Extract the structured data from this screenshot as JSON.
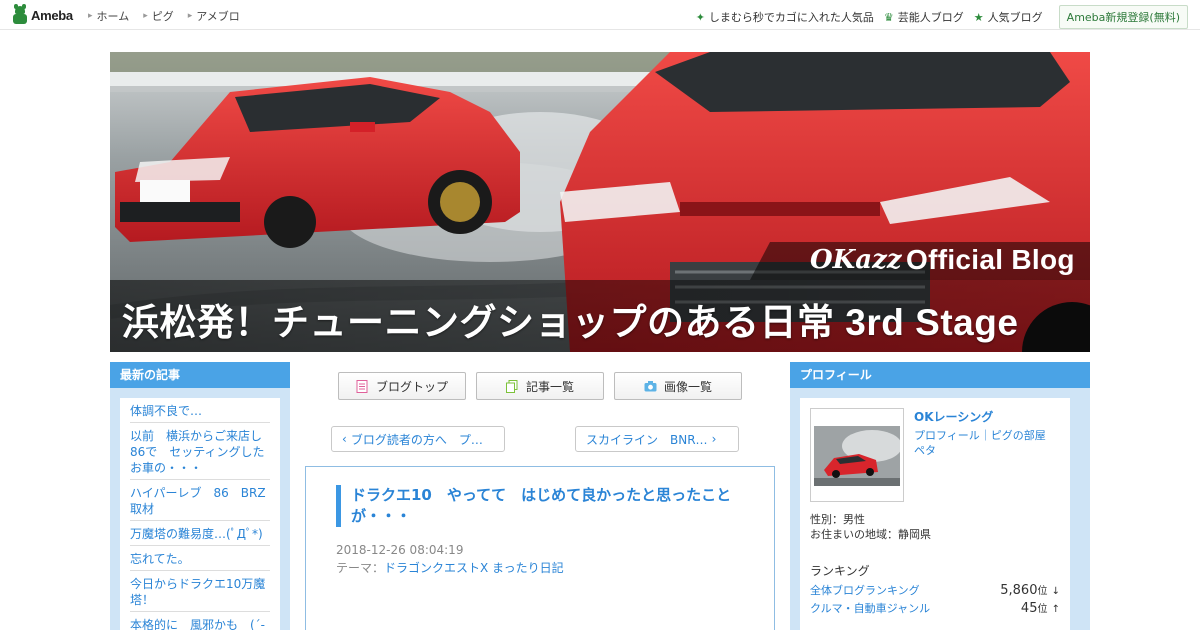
{
  "topbar": {
    "logo_text": "Ameba",
    "nav": [
      "ホーム",
      "ピグ",
      "アメブロ"
    ],
    "links": [
      {
        "label": "しまむら秒でカゴに入れた人気品",
        "icon": "sparkle-icon"
      },
      {
        "label": "芸能人ブログ",
        "icon": "crown-icon"
      },
      {
        "label": "人気ブログ",
        "icon": "star-icon"
      }
    ],
    "register_label": "Ameba新規登録(無料)"
  },
  "banner": {
    "signature": "OKazz",
    "official": "Official Blog",
    "title": "浜松発！チューニングショップのある日常 3rd Stage"
  },
  "recent": {
    "heading": "最新の記事",
    "items": [
      "体調不良で…",
      "以前　横浜からご来店し　86で　セッティングしたお車の・・・",
      "ハイパーレブ　86　BRZ取材",
      "万魔塔の難易度…(ﾟДﾟ*)",
      "忘れてた。",
      "今日からドラクエ10万魔塔！",
      "本格的に　風邪かも　(´-`)"
    ]
  },
  "center": {
    "buttons": [
      "ブログトップ",
      "記事一覧",
      "画像一覧"
    ],
    "prev_label": "ブログ読者の方へ　プ…",
    "next_label": "スカイライン　BNR…",
    "article": {
      "title": "ドラクエ10　やってて　はじめて良かったと思ったことが・・・",
      "date": "2018-12-26 08:04:19",
      "theme_prefix": "テーマ：",
      "theme": "ドラゴンクエストX まったり日記"
    }
  },
  "profile": {
    "heading": "プロフィール",
    "name": "OKレーシング",
    "links": "プロフィール｜ピグの部屋",
    "links2": "ペタ",
    "gender": "性別：男性",
    "region": "お住まいの地域：静岡県",
    "ranking_heading": "ランキング",
    "ranks": [
      {
        "label": "全体ブログランキング",
        "value": "5,860",
        "unit": "位",
        "trend": "↓"
      },
      {
        "label": "クルマ・自動車ジャンル",
        "value": "45",
        "unit": "位",
        "trend": "↑"
      }
    ]
  },
  "colors": {
    "accent_blue": "#4aa3e6",
    "link_blue": "#2a84d6",
    "sidebar_bg": "#cfe4f6",
    "ameba_green": "#2d8c3c",
    "car_red": "#d8252c"
  }
}
